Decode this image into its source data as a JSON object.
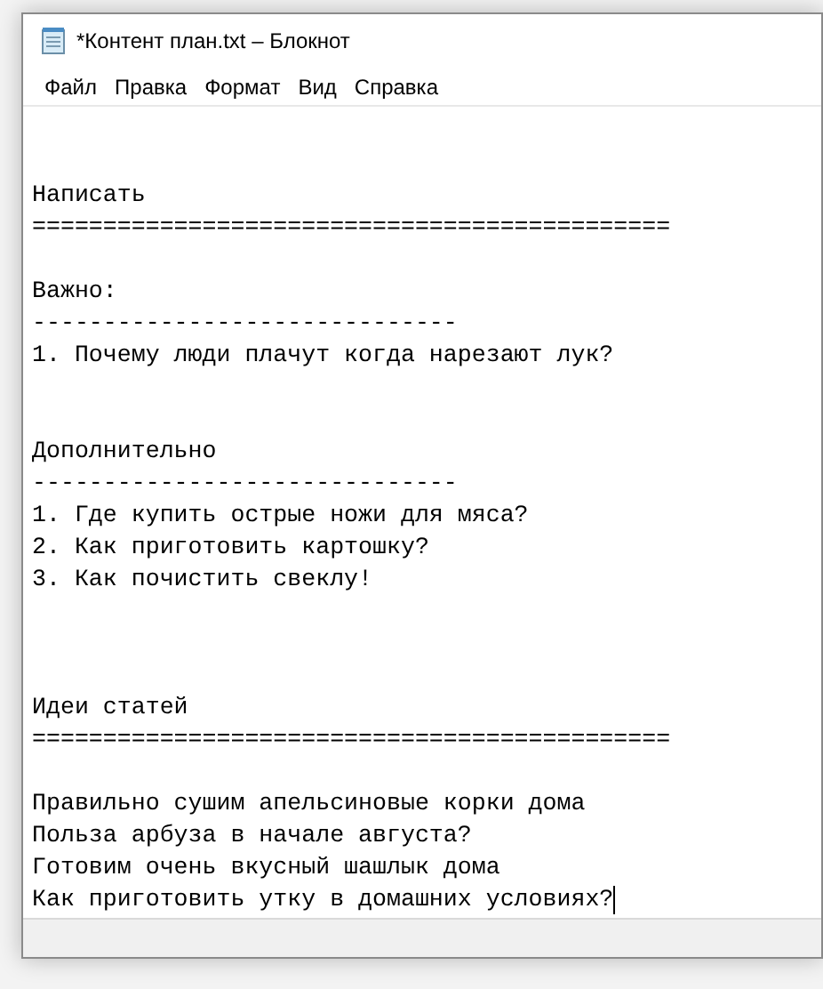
{
  "window": {
    "title": "*Контент план.txt – Блокнот"
  },
  "menu": [
    "Файл",
    "Правка",
    "Формат",
    "Вид",
    "Справка"
  ],
  "document": {
    "lines": [
      {
        "kind": "blank"
      },
      {
        "kind": "blank"
      },
      {
        "kind": "text",
        "text": "Написать"
      },
      {
        "kind": "text",
        "text": "============================================="
      },
      {
        "kind": "blank"
      },
      {
        "kind": "text",
        "text": "Важно:"
      },
      {
        "kind": "text",
        "text": "------------------------------"
      },
      {
        "kind": "text",
        "text": "1. Почему люди плачут когда нарезают лук?"
      },
      {
        "kind": "blank"
      },
      {
        "kind": "blank"
      },
      {
        "kind": "text",
        "text": "Дополнительно"
      },
      {
        "kind": "text",
        "text": "------------------------------"
      },
      {
        "kind": "text",
        "text": "1. Где купить острые ножи для мяса?"
      },
      {
        "kind": "text",
        "text": "2. Как приготовить картошку?"
      },
      {
        "kind": "text",
        "text": "3. Как почистить свеклу!"
      },
      {
        "kind": "blank"
      },
      {
        "kind": "blank"
      },
      {
        "kind": "blank"
      },
      {
        "kind": "text",
        "text": "Идеи статей"
      },
      {
        "kind": "text",
        "text": "============================================="
      },
      {
        "kind": "blank"
      },
      {
        "kind": "text",
        "text": "Правильно сушим апельсиновые корки дома"
      },
      {
        "kind": "text",
        "text": "Польза арбуза в начале августа?"
      },
      {
        "kind": "text",
        "text": "Готовим очень вкусный шашлык дома"
      },
      {
        "kind": "text",
        "text": "Как приготовить утку в домашних условиях?",
        "caret": true
      }
    ]
  }
}
